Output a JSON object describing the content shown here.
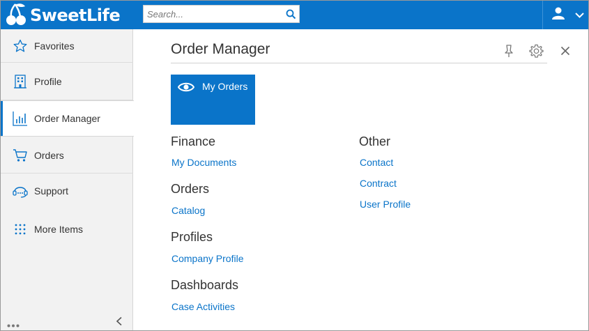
{
  "app": {
    "brand": "SweetLife",
    "accent_color": "#0a74c9",
    "logo_icon": "cherries-icon"
  },
  "search": {
    "placeholder": "Search...",
    "value": "",
    "icon": "search-icon"
  },
  "header": {
    "user_icon": "user-icon",
    "menu_icon": "chevron-down-icon"
  },
  "sidebar": {
    "items": [
      {
        "label": "Favorites",
        "icon": "star-icon",
        "active": false
      },
      {
        "label": "Profile",
        "icon": "building-icon",
        "active": false
      },
      {
        "label": "Order Manager",
        "icon": "bar-chart-icon",
        "active": true
      },
      {
        "label": "Orders",
        "icon": "cart-icon",
        "active": false
      },
      {
        "label": "Support",
        "icon": "headset-icon",
        "active": false
      },
      {
        "label": "More Items",
        "icon": "grid-dots-icon",
        "active": false
      }
    ],
    "footer": {
      "more_icon": "ellipsis-icon",
      "collapse_icon": "chevron-left-icon"
    }
  },
  "main": {
    "title": "Order Manager",
    "actions": [
      "pin-icon",
      "gear-icon",
      "close-icon"
    ],
    "tile": {
      "label": "My Orders",
      "icon": "eye-icon"
    },
    "columns": [
      {
        "sections": [
          {
            "title": "Finance",
            "links": [
              "My Documents"
            ]
          },
          {
            "title": "Orders",
            "links": [
              "Catalog"
            ]
          },
          {
            "title": "Profiles",
            "links": [
              "Company Profile"
            ]
          },
          {
            "title": "Dashboards",
            "links": [
              "Case Activities"
            ]
          }
        ]
      },
      {
        "sections": [
          {
            "title": "Other",
            "links": [
              "Contact",
              "Contract",
              "User Profile"
            ]
          }
        ]
      }
    ]
  }
}
